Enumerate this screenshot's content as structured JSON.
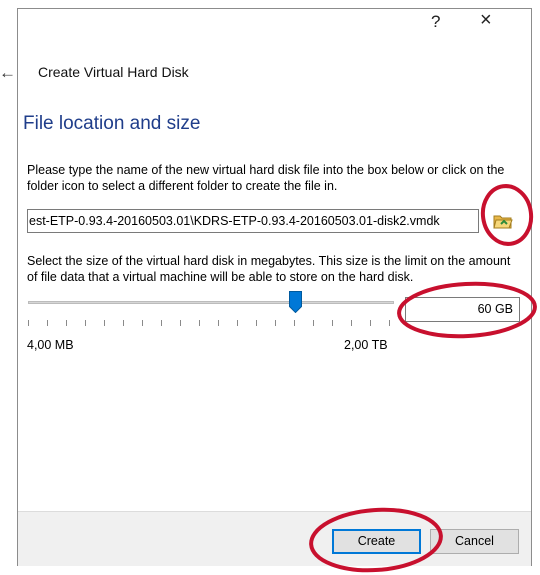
{
  "window": {
    "help_glyph": "?",
    "close_glyph": "×",
    "back_glyph": "←",
    "title": "Create Virtual Hard Disk"
  },
  "section": {
    "title": "File location and size"
  },
  "file_location": {
    "description": "Please type the name of the new virtual hard disk file into the box below or click on the folder icon to select a different folder to create the file in.",
    "path_value": "est-ETP-0.93.4-20160503.01\\KDRS-ETP-0.93.4-20160503.01-disk2.vmdk",
    "folder_icon": "folder-open-icon"
  },
  "file_size": {
    "description": "Select the size of the virtual hard disk in megabytes. This size is the limit on the amount of file data that a virtual machine will be able to store on the hard disk.",
    "value": "60 GB",
    "min_label": "4,00 MB",
    "max_label": "2,00 TB"
  },
  "buttons": {
    "create": "Create",
    "cancel": "Cancel"
  },
  "colors": {
    "accent": "#0078d7",
    "section_title": "#1f3d8a",
    "annotation": "#c8102e",
    "folder": "#e8b84a"
  }
}
